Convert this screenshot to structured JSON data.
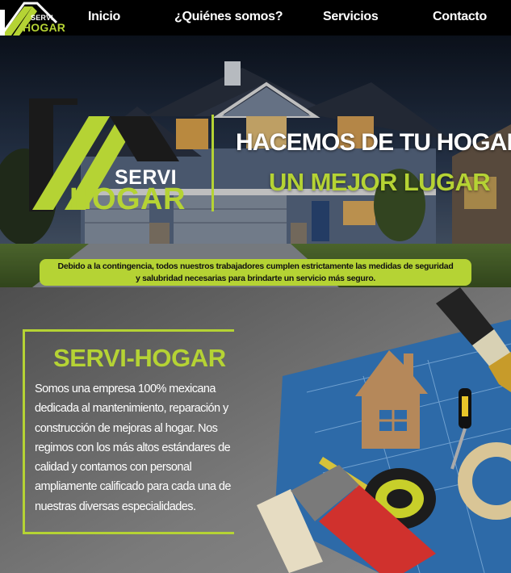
{
  "brand": {
    "servi": "SERVI",
    "hogar": "HOGAR",
    "green": "#b5d334"
  },
  "nav": {
    "items": [
      {
        "label": "Inicio"
      },
      {
        "label": "¿Quiénes somos?"
      },
      {
        "label": "Servicios"
      },
      {
        "label": "Contacto"
      }
    ]
  },
  "hero": {
    "title_line1": "HACEMOS DE TU HOGAR",
    "title_line2": "UN MEJOR LUGAR",
    "notice_line1": "Debido a la contingencia, todos nuestros trabajadores cumplen estrictamente las medidas de seguridad",
    "notice_line2": "y salubridad necesarias para brindarte un servicio más seguro."
  },
  "about": {
    "title": "SERVI-HOGAR",
    "text": "Somos una empresa 100% mexicana dedicada al mantenimiento, reparación y construcción de mejoras al hogar. Nos regimos con los más altos estándares de calidad y contamos con personal ampliamente calificado para cada una de nuestras diversas especialidades."
  }
}
